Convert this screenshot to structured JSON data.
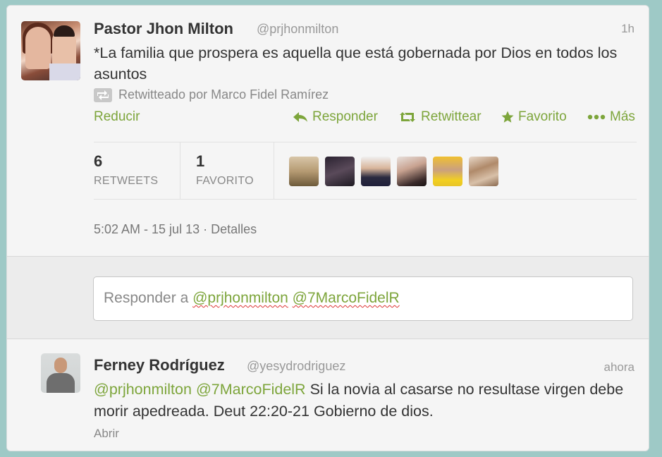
{
  "tweet": {
    "author_name": "Pastor Jhon Milton",
    "handle": "@prjhonmilton",
    "time": "1h",
    "text": "*La familia que prospera es aquella que está gobernada por Dios en todos los asuntos",
    "retweeted_by": "Retwitteado por Marco Fidel Ramírez",
    "actions": {
      "collapse": "Reducir",
      "reply": "Responder",
      "retweet": "Retwittear",
      "favorite": "Favorito",
      "more": "Más"
    },
    "stats": {
      "retweets_count": "6",
      "retweets_label": "RETWEETS",
      "favorites_count": "1",
      "favorites_label": "FAVORITO"
    },
    "timestamp": "5:02 AM - 15 jul 13",
    "details_link": "Detalles"
  },
  "reply_box": {
    "prefix": "Responder a",
    "mention1": "@prjhonmilton",
    "mention2": "@7MarcoFidelR"
  },
  "reply_tweet": {
    "author_name": "Ferney Rodríguez",
    "handle": "@yesydrodriguez",
    "time": "ahora",
    "mention1": "@prjhonmilton",
    "mention2": "@7MarcoFidelR",
    "text": "Si la novia al casarse no resultase virgen debe morir apedreada. Deut 22:20-21 Gobierno de dios.",
    "open_link": "Abrir"
  },
  "colors": {
    "link_green": "#7da53b",
    "background": "#9ec9c6",
    "card": "#f5f5f5"
  }
}
